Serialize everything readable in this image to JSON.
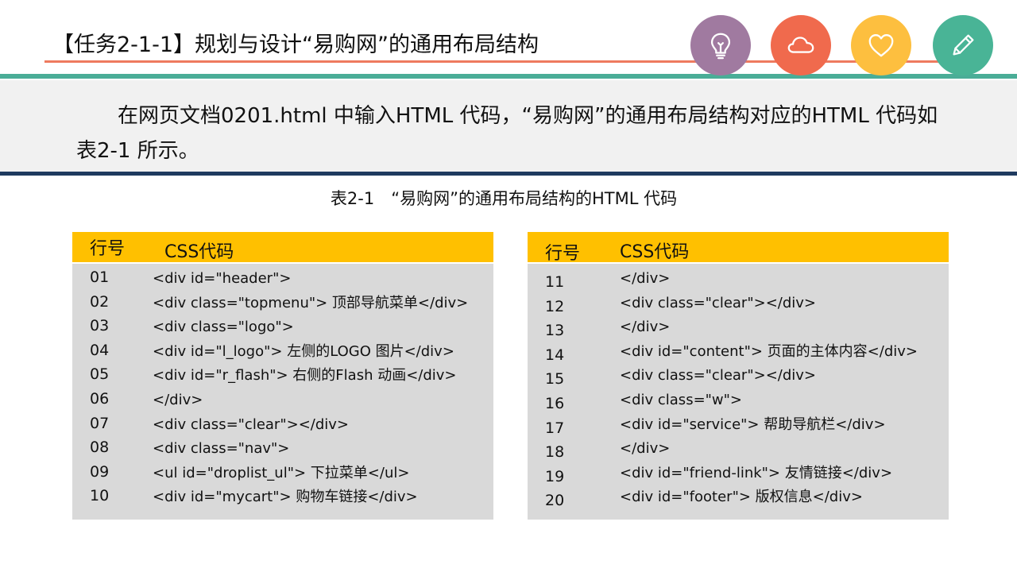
{
  "header": {
    "title": "【任务2-1-1】规划与设计“易购网”的通用布局结构",
    "icons": [
      {
        "name": "lightbulb-icon",
        "color": "#a07aa0"
      },
      {
        "name": "cloud-icon",
        "color": "#f06a4d"
      },
      {
        "name": "heart-icon",
        "color": "#fdbf3f"
      },
      {
        "name": "pencil-icon",
        "color": "#49b496"
      }
    ]
  },
  "intro": {
    "text": "在网页文档0201.html 中输入HTML 代码，“易购网”的通用布局结构对应的HTML 代码如表2-1 所示。"
  },
  "table_caption": "表2-1　“易购网”的通用布局结构的HTML 代码",
  "tables": [
    {
      "header": {
        "lineno": "行号",
        "code": "CSS代码"
      },
      "rows": [
        {
          "lineno": "01",
          "code": "<div id=\"header\">"
        },
        {
          "lineno": "02",
          "code": "<div class=\"topmenu\"> 顶部导航菜单</div>"
        },
        {
          "lineno": "03",
          "code": "<div class=\"logo\">"
        },
        {
          "lineno": "04",
          "code": "<div id=\"l_logo\"> 左侧的LOGO 图片</div>"
        },
        {
          "lineno": "05",
          "code": "<div id=\"r_flash\"> 右侧的Flash 动画</div>"
        },
        {
          "lineno": "06",
          "code": "</div>"
        },
        {
          "lineno": "07",
          "code": "<div class=\"clear\"></div>"
        },
        {
          "lineno": "08",
          "code": "<div class=\"nav\">"
        },
        {
          "lineno": "09",
          "code": "<ul id=\"droplist_ul\"> 下拉菜单</ul>"
        },
        {
          "lineno": "10",
          "code": "<div id=\"mycart\"> 购物车链接</div>"
        }
      ]
    },
    {
      "header": {
        "lineno": "行号",
        "code": "CSS代码"
      },
      "rows": [
        {
          "lineno": "11",
          "code": "</div>"
        },
        {
          "lineno": "12",
          "code": "<div class=\"clear\"></div>"
        },
        {
          "lineno": "13",
          "code": "</div>"
        },
        {
          "lineno": "14",
          "code": "<div id=\"content\"> 页面的主体内容</div>"
        },
        {
          "lineno": "15",
          "code": "<div class=\"clear\"></div>"
        },
        {
          "lineno": "16",
          "code": "<div class=\"w\">"
        },
        {
          "lineno": "17",
          "code": "<div id=\"service\"> 帮助导航栏</div>"
        },
        {
          "lineno": "18",
          "code": "</div>"
        },
        {
          "lineno": "19",
          "code": "<div id=\"friend-link\"> 友情链接</div>"
        },
        {
          "lineno": "20",
          "code": "<div id=\"footer\"> 版权信息</div>"
        }
      ]
    }
  ]
}
